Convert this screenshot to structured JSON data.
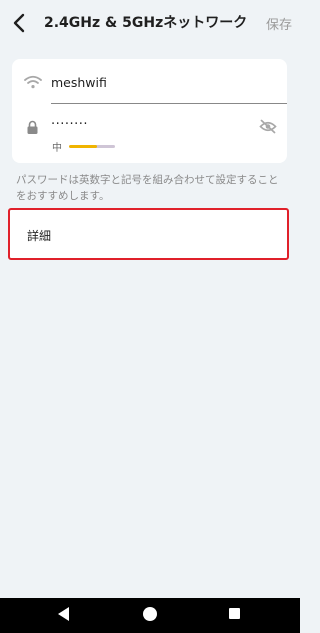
{
  "header": {
    "title": "2.4GHz & 5GHzネットワーク",
    "save_label": "保存"
  },
  "network": {
    "ssid": "meshwifi",
    "password_masked": "········",
    "strength": {
      "label": "中",
      "level": 0.6,
      "fill_color": "#f0b400",
      "track_color": "#cfc5d6"
    }
  },
  "hint": "パスワードは英数字と記号を組み合わせて設定することをおすすめします。",
  "details": {
    "label": "詳細",
    "highlight_color": "#e0202a"
  },
  "icons": {
    "back": "chevron-left-icon",
    "wifi": "wifi-icon",
    "lock": "lock-icon",
    "visibility": "eye-off-icon",
    "nav_back": "triangle-back-icon",
    "nav_home": "circle-home-icon",
    "nav_recent": "square-recent-icon"
  }
}
